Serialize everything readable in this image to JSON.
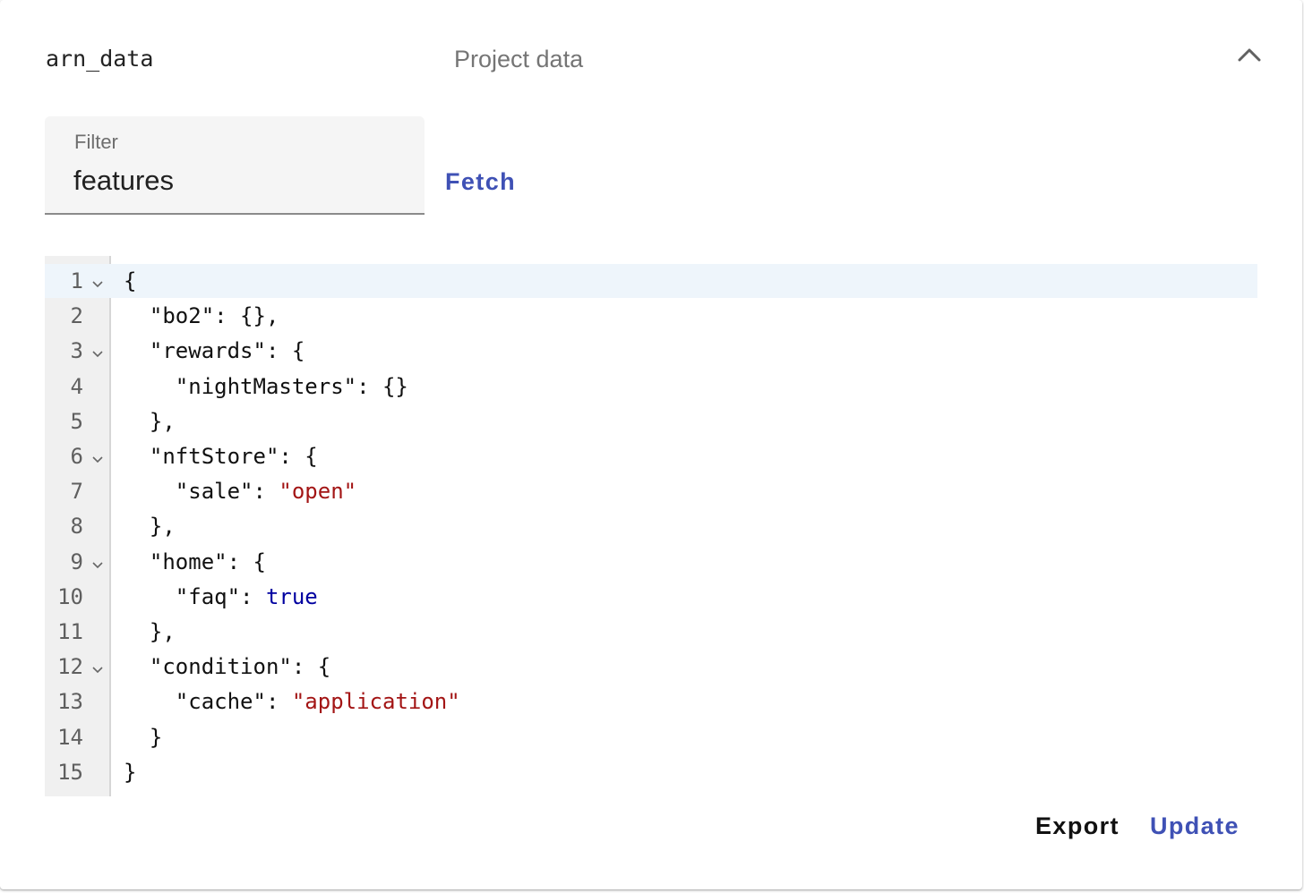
{
  "panel": {
    "key": "arn_data",
    "description": "Project data"
  },
  "filter": {
    "label": "Filter",
    "value": "features"
  },
  "buttons": {
    "fetch": "Fetch",
    "export": "Export",
    "update": "Update"
  },
  "icons": {
    "collapse": "chevron-up-icon",
    "fold": "fold-chevron-icon"
  },
  "editor": {
    "lines": [
      {
        "number": "1",
        "foldable": true,
        "parts": [
          {
            "t": "{"
          }
        ]
      },
      {
        "number": "2",
        "foldable": false,
        "parts": [
          {
            "t": "  \"bo2\": {},"
          }
        ]
      },
      {
        "number": "3",
        "foldable": true,
        "parts": [
          {
            "t": "  \"rewards\": {"
          }
        ]
      },
      {
        "number": "4",
        "foldable": false,
        "parts": [
          {
            "t": "    \"nightMasters\": {}"
          }
        ]
      },
      {
        "number": "5",
        "foldable": false,
        "parts": [
          {
            "t": "  },"
          }
        ]
      },
      {
        "number": "6",
        "foldable": true,
        "parts": [
          {
            "t": "  \"nftStore\": {"
          }
        ]
      },
      {
        "number": "7",
        "foldable": false,
        "parts": [
          {
            "t": "    \"sale\": "
          },
          {
            "t": "\"open\"",
            "k": "str"
          }
        ]
      },
      {
        "number": "8",
        "foldable": false,
        "parts": [
          {
            "t": "  },"
          }
        ]
      },
      {
        "number": "9",
        "foldable": true,
        "parts": [
          {
            "t": "  \"home\": {"
          }
        ]
      },
      {
        "number": "10",
        "foldable": false,
        "parts": [
          {
            "t": "    \"faq\": "
          },
          {
            "t": "true",
            "k": "bool"
          }
        ]
      },
      {
        "number": "11",
        "foldable": false,
        "parts": [
          {
            "t": "  },"
          }
        ]
      },
      {
        "number": "12",
        "foldable": true,
        "parts": [
          {
            "t": "  \"condition\": {"
          }
        ]
      },
      {
        "number": "13",
        "foldable": false,
        "parts": [
          {
            "t": "    \"cache\": "
          },
          {
            "t": "\"application\"",
            "k": "str"
          }
        ]
      },
      {
        "number": "14",
        "foldable": false,
        "parts": [
          {
            "t": "  }"
          }
        ]
      },
      {
        "number": "15",
        "foldable": false,
        "parts": [
          {
            "t": "}"
          }
        ]
      }
    ],
    "active_line": 1
  },
  "colors": {
    "accent": "#3f51b5",
    "string": "#a31515",
    "boolean": "#0000a0"
  }
}
